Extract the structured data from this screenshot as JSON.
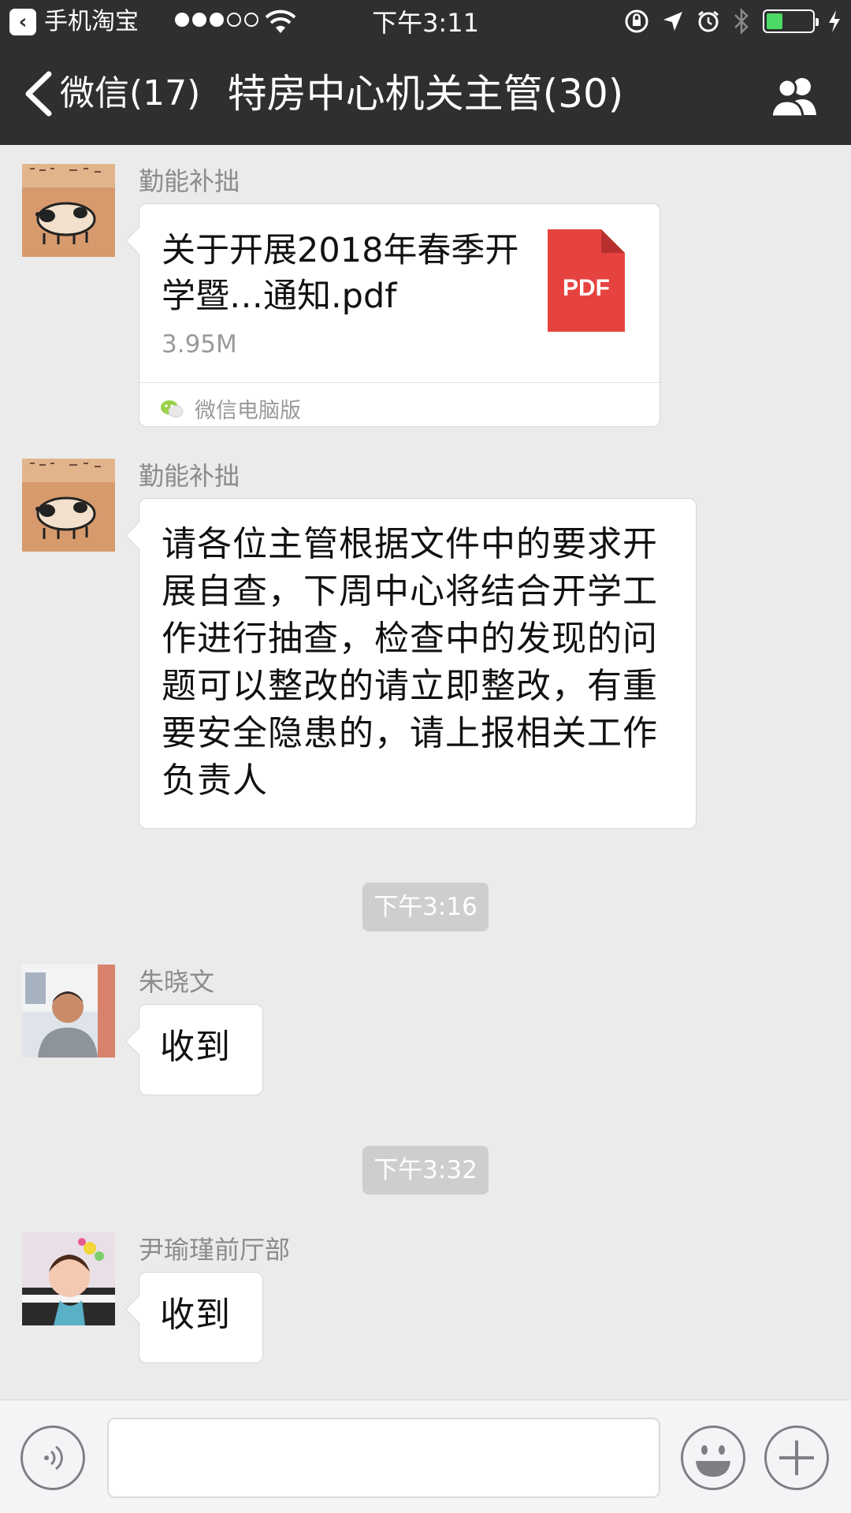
{
  "status_bar": {
    "back_app": "手机淘宝",
    "time": "下午3:11",
    "battery_level": 0.35
  },
  "nav": {
    "back_label": "微信(17)",
    "title": "特房中心机关主管(30)"
  },
  "messages": [
    {
      "sender": "勤能补拙",
      "file_name": "关于开展2018年春季开学暨…通知.pdf",
      "file_size": "3.95M",
      "file_type": "PDF",
      "source": "微信电脑版"
    },
    {
      "sender": "勤能补拙",
      "text": "请各位主管根据文件中的要求开展自查，下周中心将结合开学工作进行抽查，检查中的发现的问题可以整改的请立即整改，有重要安全隐患的，请上报相关工作负责人"
    },
    {
      "timestamp": "下午3:16"
    },
    {
      "sender": "朱晓文",
      "text": "收到"
    },
    {
      "timestamp": "下午3:32"
    },
    {
      "sender": "尹瑜瑾前厅部",
      "text": "收到"
    }
  ],
  "colors": {
    "nav_bg": "#2f2f31",
    "chat_bg": "#ebebeb",
    "pdf_red": "#e64340",
    "battery_green": "#4cd964"
  },
  "icons": [
    "back-chevron-icon",
    "group-members-icon",
    "pdf-icon",
    "wechat-logo-icon",
    "voice-icon",
    "emoji-icon",
    "plus-icon"
  ]
}
